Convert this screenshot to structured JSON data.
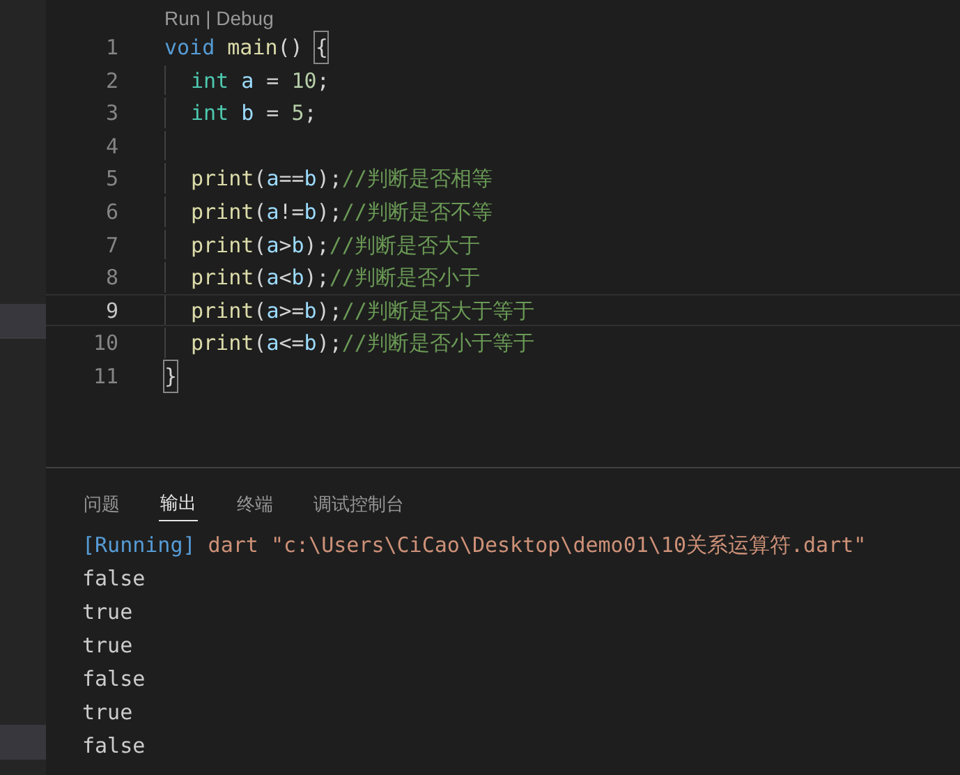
{
  "editor": {
    "codelens": "Run | Debug",
    "lines": [
      {
        "number": "1",
        "current": false,
        "tokens": [
          {
            "kind": "keyword",
            "text": "void "
          },
          {
            "kind": "function",
            "text": "main"
          },
          {
            "kind": "plain",
            "text": "() "
          },
          {
            "kind": "bracket_match",
            "text": "{"
          }
        ],
        "children": [
          {
            "number": "2",
            "current": false,
            "tokens": [
              {
                "kind": "type",
                "text": "int "
              },
              {
                "kind": "variable",
                "text": "a"
              },
              {
                "kind": "plain",
                "text": " = "
              },
              {
                "kind": "number",
                "text": "10"
              },
              {
                "kind": "plain",
                "text": ";"
              }
            ]
          },
          {
            "number": "3",
            "current": false,
            "tokens": [
              {
                "kind": "type",
                "text": "int "
              },
              {
                "kind": "variable",
                "text": "b"
              },
              {
                "kind": "plain",
                "text": " = "
              },
              {
                "kind": "number",
                "text": "5"
              },
              {
                "kind": "plain",
                "text": ";"
              }
            ]
          },
          {
            "number": "4",
            "current": false
          },
          {
            "number": "5",
            "current": false,
            "tokens": [
              {
                "kind": "function",
                "text": "print"
              },
              {
                "kind": "plain",
                "text": "("
              },
              {
                "kind": "variable",
                "text": "a"
              },
              {
                "kind": "plain",
                "text": "=="
              },
              {
                "kind": "variable",
                "text": "b"
              },
              {
                "kind": "plain",
                "text": ");"
              },
              {
                "kind": "comment",
                "text": "//判断是否相等"
              }
            ]
          },
          {
            "number": "6",
            "current": false,
            "tokens": [
              {
                "kind": "function",
                "text": "print"
              },
              {
                "kind": "plain",
                "text": "("
              },
              {
                "kind": "variable",
                "text": "a"
              },
              {
                "kind": "plain",
                "text": "!="
              },
              {
                "kind": "variable",
                "text": "b"
              },
              {
                "kind": "plain",
                "text": ");"
              },
              {
                "kind": "comment",
                "text": "//判断是否不等"
              }
            ]
          },
          {
            "number": "7",
            "current": false,
            "tokens": [
              {
                "kind": "function",
                "text": "print"
              },
              {
                "kind": "plain",
                "text": "("
              },
              {
                "kind": "variable",
                "text": "a"
              },
              {
                "kind": "plain",
                "text": ">"
              },
              {
                "kind": "variable",
                "text": "b"
              },
              {
                "kind": "plain",
                "text": ");"
              },
              {
                "kind": "comment",
                "text": "//判断是否大于"
              }
            ]
          },
          {
            "number": "8",
            "current": false,
            "tokens": [
              {
                "kind": "function",
                "text": "print"
              },
              {
                "kind": "plain",
                "text": "("
              },
              {
                "kind": "variable",
                "text": "a"
              },
              {
                "kind": "plain",
                "text": "<"
              },
              {
                "kind": "variable",
                "text": "b"
              },
              {
                "kind": "plain",
                "text": ");"
              },
              {
                "kind": "comment",
                "text": "//判断是否小于"
              }
            ]
          },
          {
            "number": "9",
            "current": true,
            "tokens": [
              {
                "kind": "function",
                "text": "print"
              },
              {
                "kind": "plain",
                "text": "("
              },
              {
                "kind": "variable",
                "text": "a"
              },
              {
                "kind": "plain",
                "text": ">="
              },
              {
                "kind": "variable",
                "text": "b"
              },
              {
                "kind": "plain",
                "text": ");"
              },
              {
                "kind": "comment",
                "text": "//判断是否大于等于"
              }
            ]
          },
          {
            "number": "10",
            "current": false,
            "tokens": [
              {
                "kind": "function",
                "text": "print"
              },
              {
                "kind": "plain",
                "text": "("
              },
              {
                "kind": "variable",
                "text": "a"
              },
              {
                "kind": "plain",
                "text": "<="
              },
              {
                "kind": "variable",
                "text": "b"
              },
              {
                "kind": "plain",
                "text": ");"
              },
              {
                "kind": "comment",
                "text": "//判断是否小于等于"
              }
            ]
          }
        ]
      },
      {
        "number": "11",
        "current": false,
        "tokens": [
          {
            "kind": "bracket_match",
            "text": "}"
          }
        ]
      }
    ]
  },
  "panel": {
    "tabs": [
      {
        "label": "问题",
        "selected": false
      },
      {
        "label": "输出",
        "selected": true
      },
      {
        "label": "终端",
        "selected": false
      },
      {
        "label": "调试控制台",
        "selected": false
      }
    ],
    "output": [
      {
        "kind": "command",
        "tag": "[Running]",
        "text": " dart \"c:\\Users\\CiCao\\Desktop\\demo01\\10关系运算符.dart\""
      },
      {
        "kind": "plain",
        "text": "false"
      },
      {
        "kind": "plain",
        "text": "true"
      },
      {
        "kind": "plain",
        "text": "true"
      },
      {
        "kind": "plain",
        "text": "false"
      },
      {
        "kind": "plain",
        "text": "true"
      },
      {
        "kind": "plain",
        "text": "false"
      }
    ]
  }
}
